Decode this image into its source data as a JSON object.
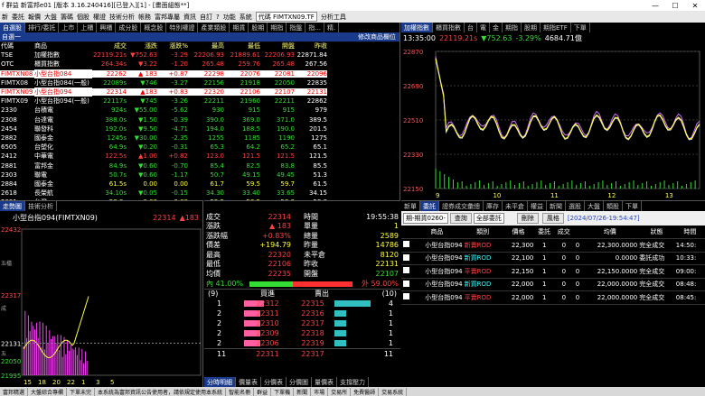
{
  "window": {
    "title": "f 群益 新富邦e01 [版本 3.16.240416][已登入][1] - [畫面組態**]",
    "controls": [
      "—",
      "☐",
      "✕"
    ]
  },
  "menubar": {
    "items": [
      "新",
      "委託",
      "報價",
      "大盤",
      "籌碼",
      "個股",
      "權證",
      "技術分析",
      "帳務",
      "富邦專屬",
      "資訊",
      "自訂",
      "?",
      "功能",
      "系統"
    ],
    "code": "代碼 FIMTXN09.TF",
    "tools": "分析工具"
  },
  "quote_panel": {
    "tabs": [
      "自選股",
      "排行/委託",
      "上市",
      "上櫃",
      "興櫃",
      "成分股",
      "概念股",
      "特別權證",
      "產業類股",
      "期貨",
      "股期",
      "期指",
      "指盤",
      "指...",
      "精."
    ],
    "header": "自選一",
    "header_right": "修改商品欄位",
    "columns": [
      "代碼",
      "商品",
      "成交",
      "漲跌",
      "漲跌%",
      "最高",
      "最低",
      "開盤",
      "昨收"
    ],
    "rows": [
      [
        "TSE",
        "加權指數",
        "22119.21s",
        "▼752.63",
        "-3.29",
        "22206.93",
        "21889.61",
        "22206.93",
        "22871.84",
        "up"
      ],
      [
        "OTC",
        "櫃買指數",
        "264.34s",
        "▼3.22",
        "-1.20",
        "265.48",
        "259.76",
        "265.48",
        "267.56",
        "up"
      ],
      [
        "FIMTXN08",
        "小型台指084",
        "22262",
        "▲ 183",
        "+0.87",
        "22298",
        "22076",
        "22081",
        "22096",
        "hl"
      ],
      [
        "FIMTX08",
        "小型台指084(一般)",
        "22089s",
        "▼746",
        "-3.27",
        "22156",
        "21918",
        "22050",
        "22835",
        "dn"
      ],
      [
        "FIMTXN09",
        "小型台指094",
        "22314",
        "▲183",
        "+0.83",
        "22320",
        "22106",
        "22107",
        "22131",
        "hl"
      ],
      [
        "FIMTX09",
        "小型台指094(一般)",
        "22117s",
        "▼745",
        "-3.26",
        "22211",
        "21960",
        "22211",
        "22862",
        "dn"
      ],
      [
        "2330",
        "台積電",
        "924s",
        "▼55.00",
        "-5.62",
        "930",
        "915",
        "915",
        "979",
        "dn"
      ],
      [
        "2308",
        "台達電",
        "388.0s",
        "▼1.50",
        "-0.39",
        "390.0",
        "369.0",
        "371.0",
        "389.5",
        "dn"
      ],
      [
        "2454",
        "聯發科",
        "192.0s",
        "▼9.50",
        "-4.71",
        "194.0",
        "188.5",
        "190.0",
        "201.5",
        "dn"
      ],
      [
        "2882",
        "國泰金",
        "1245s",
        "▼30.00",
        "-2.35",
        "1255",
        "1185",
        "1190",
        "1275",
        "dn"
      ],
      [
        "6505",
        "台塑化",
        "64.9s",
        "▼0.20",
        "-0.31",
        "65.3",
        "64.2",
        "65.2",
        "65.1",
        "dn"
      ],
      [
        "2412",
        "中華電",
        "122.5s",
        "▲1.00",
        "+0.82",
        "123.0",
        "121.5",
        "121.5",
        "121.5",
        "up"
      ],
      [
        "2881",
        "富邦金",
        "84.9s",
        "▼0.60",
        "-0.70",
        "85.4",
        "82.5",
        "83.8",
        "85.5",
        "dn"
      ],
      [
        "2303",
        "聯電",
        "50.7s",
        "▼0.60",
        "-1.17",
        "50.7",
        "49.15",
        "49.45",
        "51.3",
        "dn"
      ],
      [
        "2884",
        "國泰金",
        "61.5s",
        "0.00",
        "0.00",
        "61.7",
        "59.5",
        "59.7",
        "61.5",
        "yl"
      ],
      [
        "2618",
        "長榮航",
        "34.10s",
        "▼0.05",
        "-0.15",
        "34.30",
        "33.40",
        "33.65",
        "34.15",
        "dn"
      ],
      [
        "2891",
        "台灣",
        "58.8s",
        "0.00",
        "0.00",
        "59.2",
        "58.2",
        "58.8",
        "58.8",
        "yl"
      ],
      [
        "2002",
        "中鋼",
        "22.90s",
        "▲0.10",
        "+0.44",
        "23.05",
        "22.80",
        "23.05",
        "22.80",
        "up"
      ],
      [
        "3008",
        "大立光",
        "2770s",
        "▼75.00",
        "-2.64",
        "2800",
        "2710",
        "2740",
        "2845",
        "dn"
      ]
    ]
  },
  "index_panel": {
    "tabs": [
      "加權指數",
      "櫃買指數",
      "台",
      "電",
      "金",
      "期指",
      "股期",
      "期指ETF",
      "下單"
    ],
    "time": "13:35:00",
    "value": "22119.21s",
    "change": "▼752.63",
    "pct": "-3.29%",
    "volume": "4684.71億",
    "y_labels": [
      "22870",
      "22690",
      "22510",
      "22330",
      "22150"
    ],
    "x_labels": [
      "9",
      "10",
      "11",
      "12",
      "13"
    ]
  },
  "tick_panel": {
    "tabs": [
      "走勢圖",
      "技術分析"
    ],
    "title": "小型台指094(FIMTXN09)",
    "price": "22314",
    "change": "▲183",
    "y_labels": [
      "22432",
      "22317",
      "22131",
      "22050",
      "21995"
    ],
    "x_labels": [
      "15",
      "18",
      "20",
      "22",
      "1",
      "3",
      "5",
      "13:45"
    ],
    "side_labels": [
      "五檔",
      "成",
      "五"
    ]
  },
  "detail_panel": {
    "fields": [
      [
        "成交",
        "22314",
        "時間",
        "19:55:38"
      ],
      [
        "漲跌",
        "▲ 183",
        "單量",
        "1"
      ],
      [
        "漲跌幅",
        "+0.83%",
        "總量",
        "2589"
      ],
      [
        "價差",
        "+194.79",
        "昨量",
        "14786"
      ],
      [
        "最高",
        "22320",
        "未平倉",
        "8120"
      ],
      [
        "最低",
        "22106",
        "昨收",
        "22131"
      ],
      [
        "均價",
        "22235",
        "開盤",
        "22107"
      ]
    ],
    "inner": "內 41.00%",
    "outer": "外 59.00%",
    "buy_count": "(9)",
    "sell_count": "(10)",
    "buy_head": "買進",
    "sell_head": "賣出",
    "book": [
      [
        "1",
        "22312",
        "22315",
        "4"
      ],
      [
        "2",
        "22311",
        "22316",
        "1"
      ],
      [
        "2",
        "22310",
        "22317",
        "1"
      ],
      [
        "2",
        "22309",
        "22318",
        "1"
      ],
      [
        "2",
        "22306",
        "22319",
        "1"
      ]
    ],
    "totals": [
      "11",
      "22311",
      "22317",
      "11"
    ],
    "bottom_tabs": [
      "分時明細",
      "價量表",
      "分價表",
      "分價圖",
      "量價表",
      "支撐壓力"
    ]
  },
  "order_panel": {
    "tabs": [
      "新單",
      "委託",
      "證券成交彙總",
      "庫存",
      "未平倉",
      "權益",
      "新聞",
      "選股",
      "大盤",
      "類股",
      "下單"
    ],
    "account_select": "期-期貨0260-",
    "query": "查詢",
    "filter": "全部委託",
    "delete": "刪除",
    "risk": "風格",
    "datetime": "[2024/07/26-19:54:47]",
    "columns": [
      "",
      "商品",
      "類別",
      "價格",
      "委託",
      "成交",
      "",
      "均價",
      "狀態",
      "時間"
    ],
    "rows": [
      [
        "小型台指094",
        "新賣ROD",
        "22,300",
        "1",
        "0",
        "0",
        "22,300.0000",
        "完全成交",
        "14:50:",
        "up"
      ],
      [
        "小型台指094",
        "新買ROD",
        "22,100",
        "1",
        "0",
        "0",
        "0.0000",
        "委託成功",
        "10:33:",
        "cy"
      ],
      [
        "小型台指094",
        "平賣ROD",
        "22,150",
        "1",
        "0",
        "0",
        "22,150.0000",
        "完全成交",
        "09:00:",
        "up"
      ],
      [
        "小型台指094",
        "新買ROD",
        "22,000",
        "1",
        "0",
        "0",
        "22,000.0000",
        "完全成交",
        "08:48:",
        "cy"
      ],
      [
        "小型台指094",
        "平賣ROD",
        "22,000",
        "1",
        "0",
        "0",
        "22,000.0000",
        "完全成交",
        "08:45:",
        "up"
      ]
    ]
  },
  "statusbar": {
    "items": [
      "富邦精選",
      "大盤綜合專欄",
      "下單未完",
      "本系統為富邦資訊公告使用者，請依規定使用本系統",
      "智能名冊",
      "群益",
      "下單機",
      "新聞",
      "市場",
      "交易所",
      "免費醫師",
      "交易系統"
    ]
  }
}
